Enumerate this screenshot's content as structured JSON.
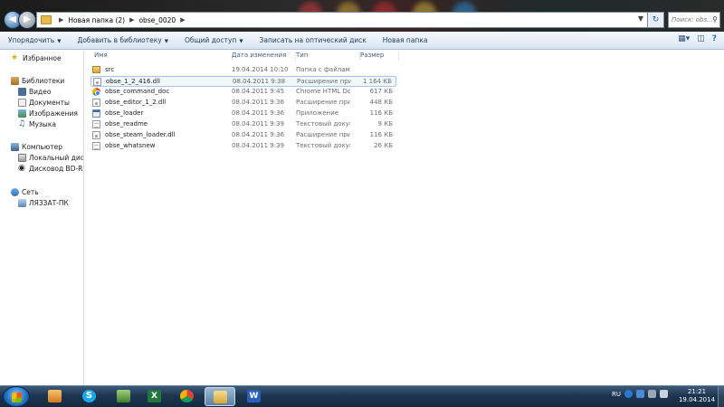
{
  "address": {
    "crumbs": [
      "Новая папка (2)",
      "obse_0020"
    ],
    "search_placeholder": "Поиск: obs..."
  },
  "toolbar": {
    "items": [
      {
        "label": "Упорядочить",
        "dropdown": true
      },
      {
        "label": "Добавить в библиотеку",
        "dropdown": true
      },
      {
        "label": "Общий доступ",
        "dropdown": true
      },
      {
        "label": "Записать на оптический диск",
        "dropdown": false
      },
      {
        "label": "Новая папка",
        "dropdown": false
      }
    ]
  },
  "sidebar": {
    "favorites": "Избранное",
    "libraries": {
      "label": "Библиотеки",
      "items": [
        "Видео",
        "Документы",
        "Изображения",
        "Музыка"
      ]
    },
    "computer": {
      "label": "Компьютер",
      "items": [
        "Локальный диск (C",
        "Дисковод BD-ROM"
      ]
    },
    "network": {
      "label": "Сеть",
      "items": [
        "ЛЯЗЗАТ-ПК"
      ]
    }
  },
  "columns": {
    "name": "Имя",
    "date": "Дата изменения",
    "type": "Тип",
    "size": "Размер"
  },
  "files": [
    {
      "name": "src",
      "date": "19.04.2014 10:10",
      "type": "Папка с файлами",
      "size": "",
      "icon": "folder-icon"
    },
    {
      "name": "obse_1_2_416.dll",
      "date": "08.04.2011 9:38",
      "type": "Расширение при...",
      "size": "1 164 КБ",
      "icon": "dll-file-icon",
      "selected": true
    },
    {
      "name": "obse_command_doc",
      "date": "08.04.2011 9:45",
      "type": "Chrome HTML Do...",
      "size": "617 КБ",
      "icon": "chrome-html-icon"
    },
    {
      "name": "obse_editor_1_2.dll",
      "date": "08.04.2011 9:36",
      "type": "Расширение при...",
      "size": "448 КБ",
      "icon": "dll-file-icon"
    },
    {
      "name": "obse_loader",
      "date": "08.04.2011 9:36",
      "type": "Приложение",
      "size": "116 КБ",
      "icon": "exe-file-icon"
    },
    {
      "name": "obse_readme",
      "date": "08.04.2011 9:39",
      "type": "Текстовый докум...",
      "size": "9 КБ",
      "icon": "text-file-icon"
    },
    {
      "name": "obse_steam_loader.dll",
      "date": "08.04.2011 9:36",
      "type": "Расширение при...",
      "size": "116 КБ",
      "icon": "dll-file-icon"
    },
    {
      "name": "obse_whatsnew",
      "date": "08.04.2011 9:39",
      "type": "Текстовый докум...",
      "size": "26 КБ",
      "icon": "text-file-icon"
    }
  ],
  "taskbar": {
    "apps": [
      {
        "icon": "media-player-icon",
        "color": "#e8a33a"
      },
      {
        "icon": "skype-icon",
        "color": "#1aa8e8"
      },
      {
        "icon": "network-app-icon",
        "color": "#4f9a3a"
      },
      {
        "icon": "excel-icon",
        "color": "#1f7a3a"
      },
      {
        "icon": "chrome-icon",
        "color": "#db4437"
      },
      {
        "icon": "explorer-icon",
        "color": "#e5c26a",
        "active": true
      },
      {
        "icon": "word-icon",
        "color": "#2b5fb8"
      }
    ],
    "lang": "RU",
    "time": "21:21",
    "date": "19.04.2014"
  }
}
